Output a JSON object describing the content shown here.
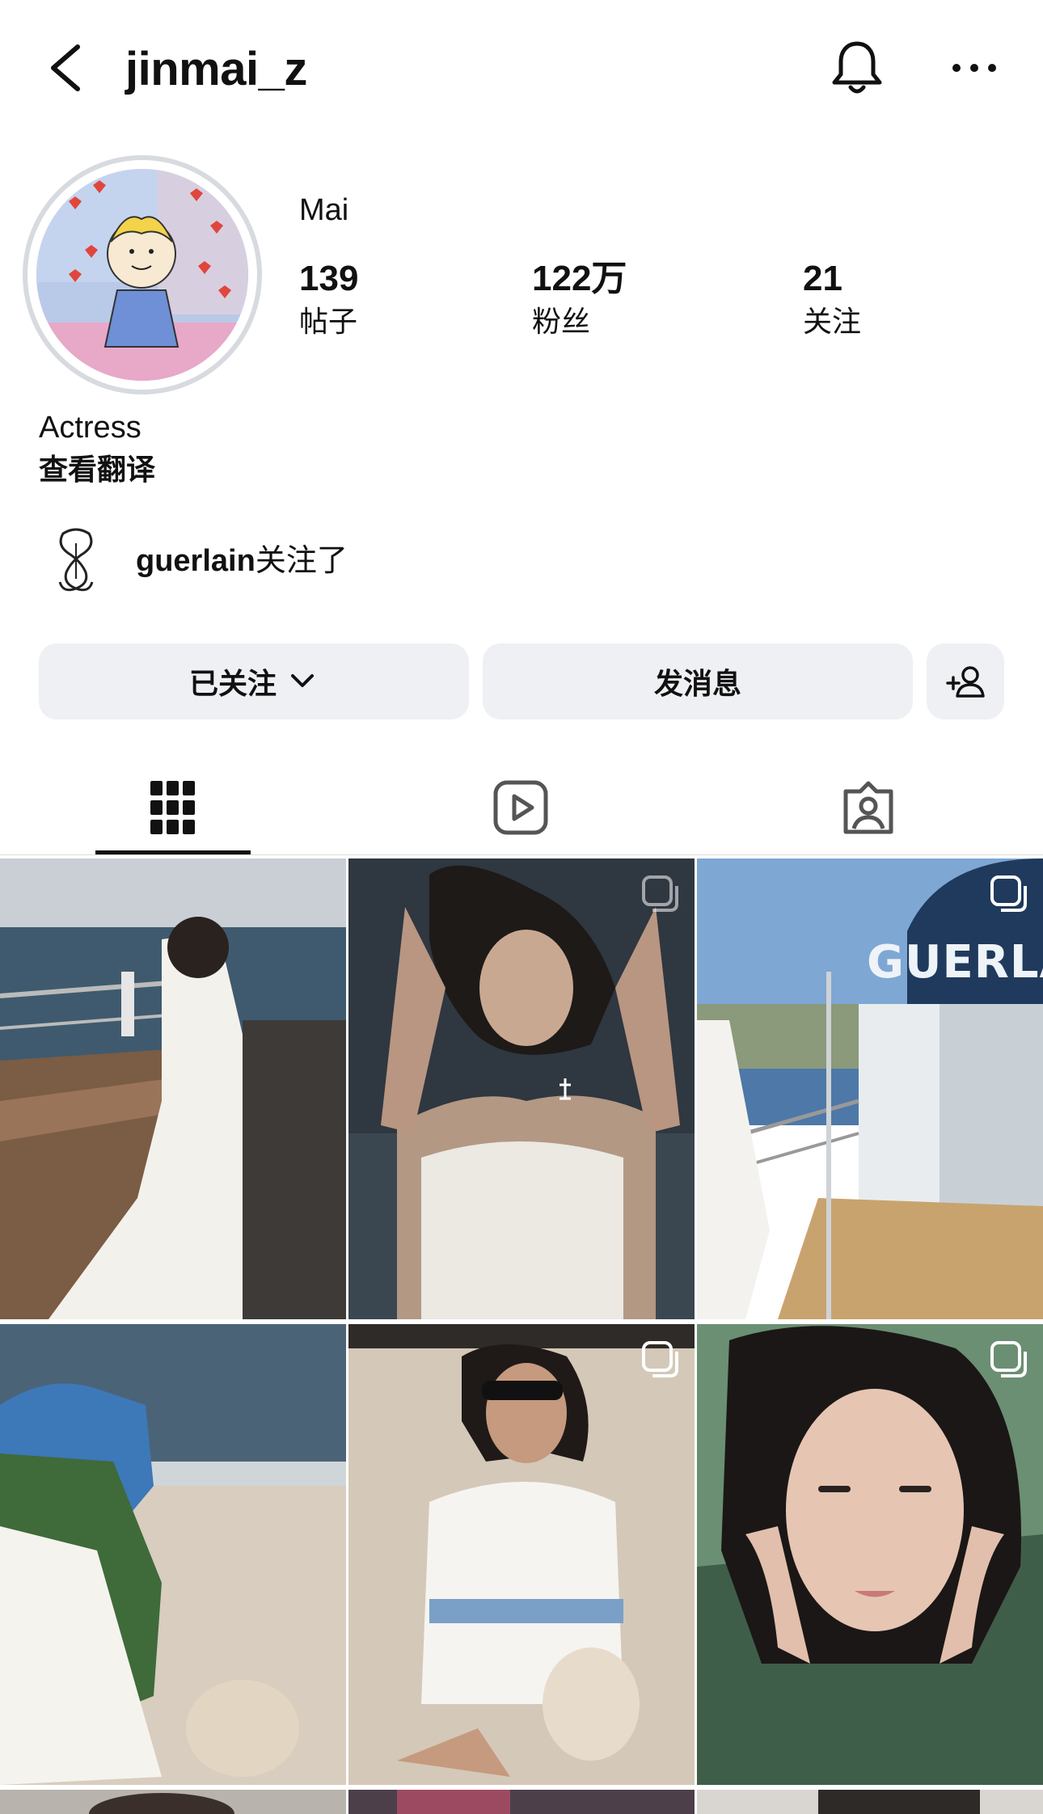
{
  "header": {
    "username": "jinmai_z",
    "icons": [
      "chevron-left-icon",
      "bell-icon",
      "more-horizontal-icon"
    ]
  },
  "profile": {
    "display_name": "Mai",
    "stats": [
      {
        "value": "139",
        "label": "帖子"
      },
      {
        "value": "122万",
        "label": "粉丝"
      },
      {
        "value": "21",
        "label": "关注"
      }
    ],
    "bio": "Actress",
    "translate_link": "查看翻译",
    "mutual": {
      "account": "guerlain",
      "suffix": "关注了"
    }
  },
  "actions": {
    "following_label": "已关注",
    "message_label": "发消息"
  },
  "tabs": [
    {
      "icon": "grid-icon",
      "active": true
    },
    {
      "icon": "reels-icon",
      "active": false
    },
    {
      "icon": "tagged-icon",
      "active": false
    }
  ],
  "photos": [
    {
      "caption": "",
      "multi": false
    },
    {
      "caption": "",
      "multi": true
    },
    {
      "caption": "GUERLA",
      "multi": true
    },
    {
      "caption": "",
      "multi": false
    },
    {
      "caption": "",
      "multi": true
    },
    {
      "caption": "",
      "multi": true
    }
  ],
  "colors": {
    "button_bg": "#eef0f3",
    "text": "#111111",
    "ring": "#d7dadf"
  }
}
